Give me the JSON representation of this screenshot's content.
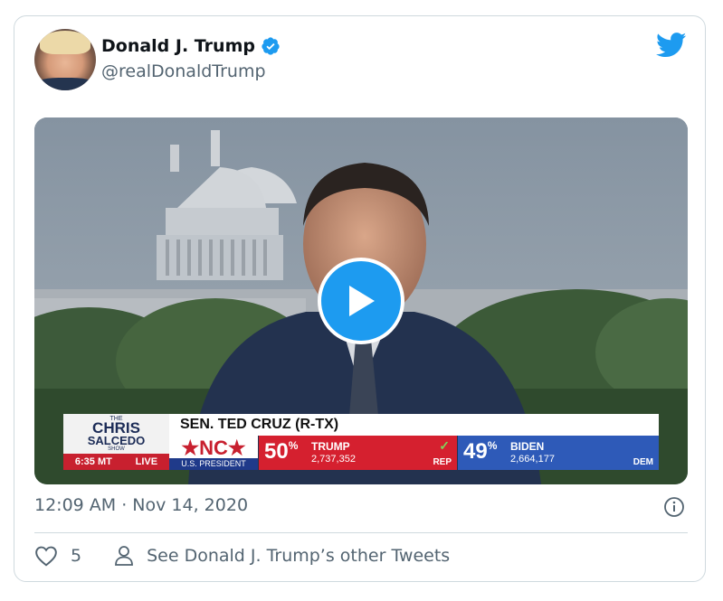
{
  "tweet": {
    "display_name": "Donald J. Trump",
    "handle": "@realDonaldTrump",
    "timestamp": "12:09 AM · Nov 14, 2020",
    "like_count": "5",
    "see_other_tweets": "See Donald J. Trump’s other Tweets"
  },
  "video": {
    "show_the": "THE",
    "show_name_line1": "CHRIS",
    "show_name_line2": "SALCEDO",
    "show_sub": "SHOW",
    "time": "6:35 MT",
    "live": "LIVE",
    "headline": "SEN. TED CRUZ (R-TX)",
    "state": "★NC★",
    "race": "U.S. PRESIDENT",
    "rep_pct": "50",
    "rep_name": "TRUMP",
    "rep_votes": "2,737,352",
    "rep_party": "REP",
    "dem_pct": "49",
    "dem_name": "BIDEN",
    "dem_votes": "2,664,177",
    "dem_party": "DEM",
    "pct_symbol": "%",
    "check": "✓"
  },
  "colors": {
    "twitter_blue": "#1d9bf0",
    "rep_red": "#d5202f",
    "dem_blue": "#2e5ab8",
    "muted_text": "#536471"
  },
  "icons": {
    "verified": "verified-badge-icon",
    "logo": "twitter-bird-icon",
    "play": "play-icon",
    "info": "info-icon",
    "heart": "heart-icon",
    "person": "person-icon"
  }
}
